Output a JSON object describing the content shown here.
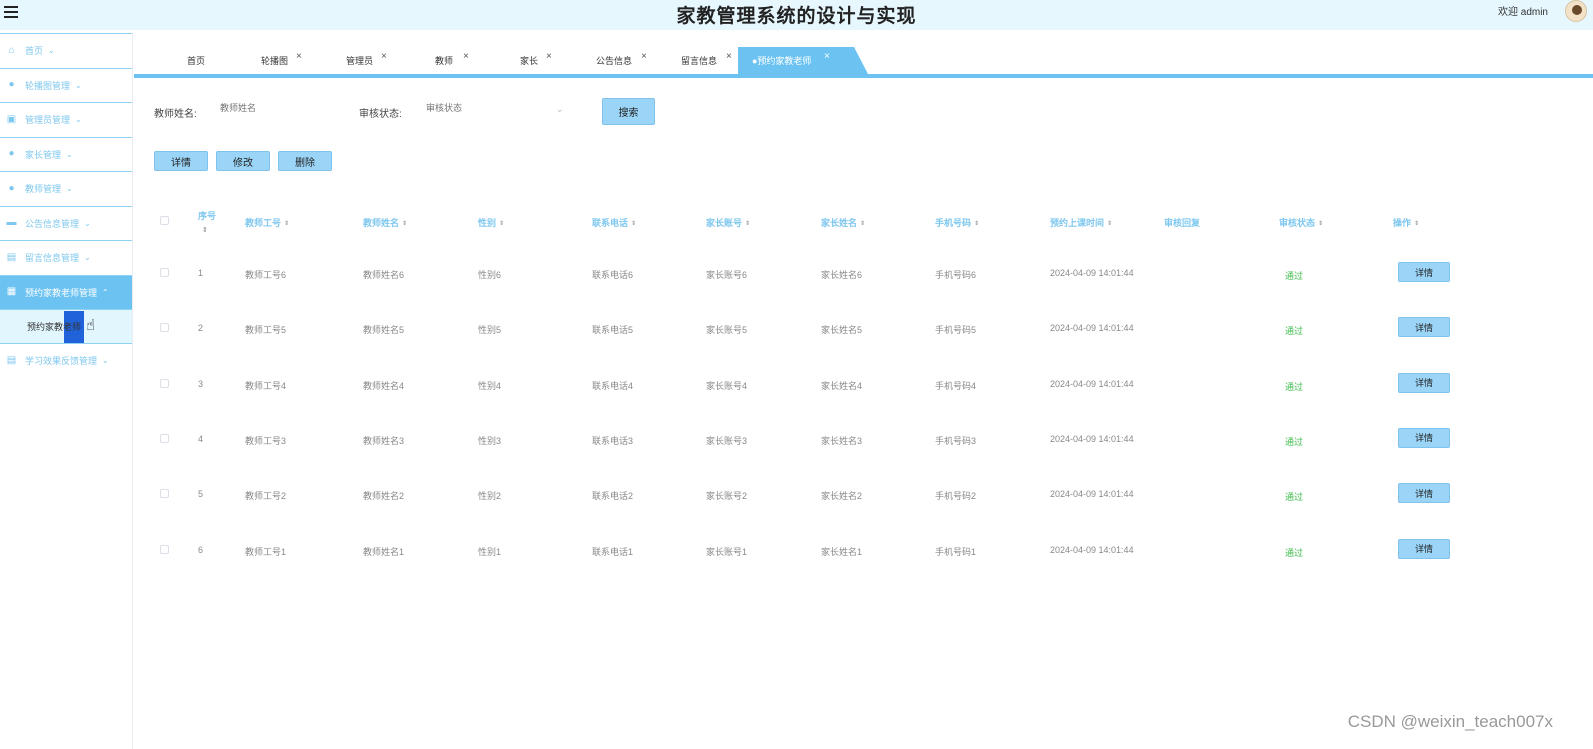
{
  "header": {
    "title": "家教管理系统的设计与实现",
    "welcome": "欢迎 admin"
  },
  "sidebar": {
    "items": [
      {
        "label": "首页",
        "icon": "home-icon",
        "glyph": "⌂"
      },
      {
        "label": "轮播图管理",
        "icon": "circle-icon",
        "glyph": "●"
      },
      {
        "label": "管理员管理",
        "icon": "edit-icon",
        "glyph": "▣"
      },
      {
        "label": "家长管理",
        "icon": "user-icon",
        "glyph": "●"
      },
      {
        "label": "教师管理",
        "icon": "user-icon",
        "glyph": "●"
      },
      {
        "label": "公告信息管理",
        "icon": "card-icon",
        "glyph": "▬"
      },
      {
        "label": "留言信息管理",
        "icon": "message-icon",
        "glyph": "▤"
      },
      {
        "label": "预约家教老师管理",
        "icon": "table-icon",
        "glyph": "▦",
        "active": true
      }
    ],
    "sub_item": "预约家教老师",
    "last_item": {
      "label": "学习效果反馈管理",
      "icon": "list-icon",
      "glyph": "▤"
    }
  },
  "tabs": [
    {
      "label": "首页",
      "closable": false
    },
    {
      "label": "轮播图",
      "closable": true
    },
    {
      "label": "管理员",
      "closable": true
    },
    {
      "label": "教师",
      "closable": true
    },
    {
      "label": "家长",
      "closable": true
    },
    {
      "label": "公告信息",
      "closable": true
    },
    {
      "label": "留言信息",
      "closable": true
    },
    {
      "label": "●预约家教老师",
      "closable": true,
      "active": true
    }
  ],
  "search": {
    "teacher_name_label": "教师姓名:",
    "teacher_name_placeholder": "教师姓名",
    "status_label": "审核状态:",
    "status_placeholder": "审核状态",
    "search_button": "搜索"
  },
  "actions": {
    "detail": "详情",
    "edit": "修改",
    "delete": "删除"
  },
  "table": {
    "columns": [
      "序号",
      "教师工号",
      "教师姓名",
      "性别",
      "联系电话",
      "家长账号",
      "家长姓名",
      "手机号码",
      "预约上课时间",
      "审核回复",
      "审核状态",
      "操作"
    ],
    "rows": [
      {
        "idx": "1",
        "tno": "教师工号6",
        "tname": "教师姓名6",
        "gender": "性别6",
        "phone": "联系电话6",
        "pacct": "家长账号6",
        "pname": "家长姓名6",
        "mobile": "手机号码6",
        "time": "2024-04-09 14:01:44",
        "reply": "",
        "status": "通过",
        "op": "详情"
      },
      {
        "idx": "2",
        "tno": "教师工号5",
        "tname": "教师姓名5",
        "gender": "性别5",
        "phone": "联系电话5",
        "pacct": "家长账号5",
        "pname": "家长姓名5",
        "mobile": "手机号码5",
        "time": "2024-04-09 14:01:44",
        "reply": "",
        "status": "通过",
        "op": "详情"
      },
      {
        "idx": "3",
        "tno": "教师工号4",
        "tname": "教师姓名4",
        "gender": "性别4",
        "phone": "联系电话4",
        "pacct": "家长账号4",
        "pname": "家长姓名4",
        "mobile": "手机号码4",
        "time": "2024-04-09 14:01:44",
        "reply": "",
        "status": "通过",
        "op": "详情"
      },
      {
        "idx": "4",
        "tno": "教师工号3",
        "tname": "教师姓名3",
        "gender": "性别3",
        "phone": "联系电话3",
        "pacct": "家长账号3",
        "pname": "家长姓名3",
        "mobile": "手机号码3",
        "time": "2024-04-09 14:01:44",
        "reply": "",
        "status": "通过",
        "op": "详情"
      },
      {
        "idx": "5",
        "tno": "教师工号2",
        "tname": "教师姓名2",
        "gender": "性别2",
        "phone": "联系电话2",
        "pacct": "家长账号2",
        "pname": "家长姓名2",
        "mobile": "手机号码2",
        "time": "2024-04-09 14:01:44",
        "reply": "",
        "status": "通过",
        "op": "详情"
      },
      {
        "idx": "6",
        "tno": "教师工号1",
        "tname": "教师姓名1",
        "gender": "性别1",
        "phone": "联系电话1",
        "pacct": "家长账号1",
        "pname": "家长姓名1",
        "mobile": "手机号码1",
        "time": "2024-04-09 14:01:44",
        "reply": "",
        "status": "通过",
        "op": "详情"
      }
    ]
  },
  "watermark": "CSDN @weixin_teach007x",
  "colors": {
    "accent": "#6cc3f2",
    "button": "#9ad4f7",
    "status_ok": "#3fbd4e",
    "header_bg": "#e6f7fe"
  }
}
